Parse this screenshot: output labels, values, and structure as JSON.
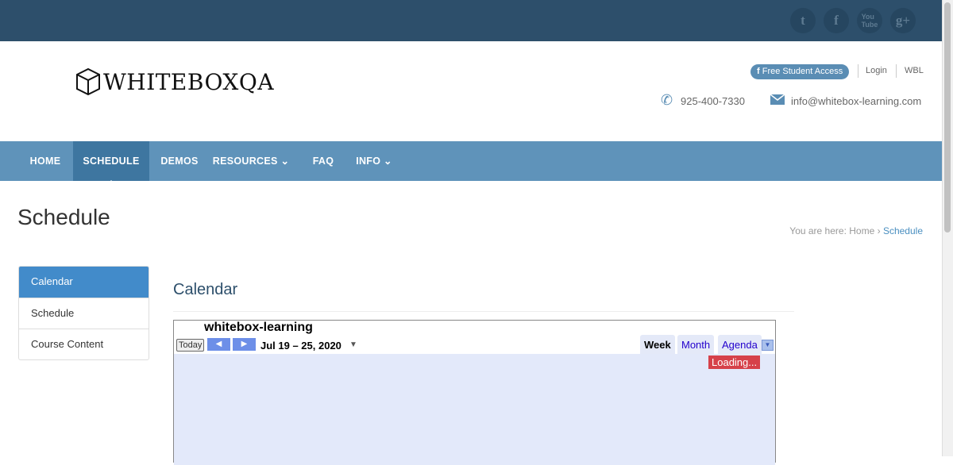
{
  "social": [
    "twitter-icon",
    "facebook-icon",
    "youtube-icon",
    "googleplus-icon"
  ],
  "logo": "WHITEBOXQA",
  "top_links": {
    "free_access": "Free Student Access",
    "login": "Login",
    "wbl": "WBL"
  },
  "contact": {
    "phone": "925-400-7330",
    "email": "info@whitebox-learning.com"
  },
  "nav": [
    {
      "label": "HOME"
    },
    {
      "label": "SCHEDULE"
    },
    {
      "label": "DEMOS"
    },
    {
      "label": "RESOURCES"
    },
    {
      "label": "FAQ"
    },
    {
      "label": "INFO"
    }
  ],
  "page_title": "Schedule",
  "breadcrumb": {
    "prefix": "You are here:",
    "home": "Home",
    "current": "Schedule"
  },
  "sidebar": [
    {
      "label": "Calendar"
    },
    {
      "label": "Schedule"
    },
    {
      "label": "Course Content"
    }
  ],
  "section_title": "Calendar",
  "calendar": {
    "title": "whitebox-learning",
    "today": "Today",
    "range": "Jul 19 – 25, 2020",
    "tabs": [
      "Week",
      "Month",
      "Agenda"
    ],
    "loading": "Loading..."
  }
}
